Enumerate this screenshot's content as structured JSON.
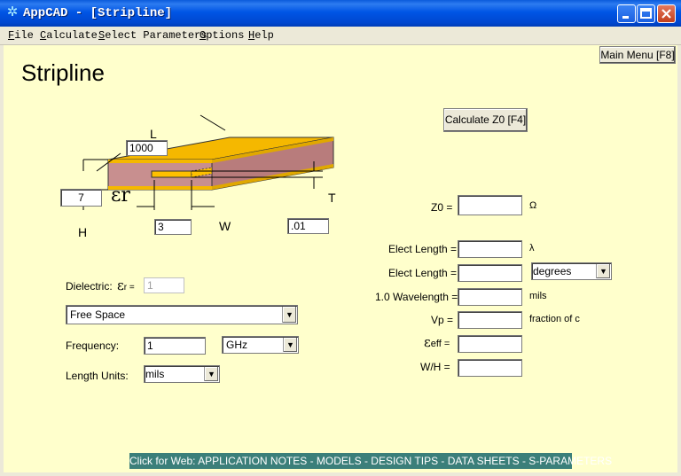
{
  "window": {
    "app_icon": "appcad-snowflake-icon",
    "title": "AppCAD - [Stripline]",
    "controls": [
      "minimize",
      "maximize",
      "close"
    ]
  },
  "menubar": [
    {
      "key": "F",
      "rest": "ile"
    },
    {
      "key": "C",
      "rest": "alculate"
    },
    {
      "key": "S",
      "rest": "elect Parameters"
    },
    {
      "key": "O",
      "rest": "ptions"
    },
    {
      "key": "H",
      "rest": "elp"
    }
  ],
  "page": {
    "title": "Stripline",
    "main_menu_button": "Main Menu [F8]",
    "calculate_button": "Calculate Z0  [F4]"
  },
  "diagram": {
    "L_label": "L",
    "L_value": "1000",
    "H_label": "H",
    "H_value": "7",
    "W_label": "W",
    "W_value": "3",
    "T_label": "T",
    "T_value": ".01",
    "er_symbol": "εr",
    "colors": {
      "top": "#F5B800",
      "body": "#C88F8F",
      "strip": "#FFC000"
    }
  },
  "inputs": {
    "dielectric_label": "Dielectric:",
    "dielectric_eps_symbol": "ε",
    "dielectric_eps_sub": "r =",
    "dielectric_eps_value": "1",
    "material_value": "Free Space",
    "frequency_label": "Frequency:",
    "frequency_value": "1",
    "frequency_unit": "GHz",
    "length_units_label": "Length Units:",
    "length_units_value": "mils"
  },
  "outputs": {
    "z0_label": "Z0 =",
    "z0_unit": "Ω",
    "elect_len1_label": "Elect Length =",
    "elect_len1_unit": "λ",
    "elect_len2_label": "Elect Length =",
    "elect_len2_unit": "degrees",
    "wavelength_label": "1.0 Wavelength =",
    "wavelength_unit": "mils",
    "vp_label": "Vp =",
    "vp_unit": "fraction of c",
    "eeff_symbol": "ε",
    "eeff_sub": "eff =",
    "wh_label": "W/H ="
  },
  "footer": {
    "web_link": "Click for Web: APPLICATION NOTES - MODELS - DESIGN TIPS - DATA SHEETS - S-PARAMETERS",
    "color": "#3B7F7A"
  }
}
